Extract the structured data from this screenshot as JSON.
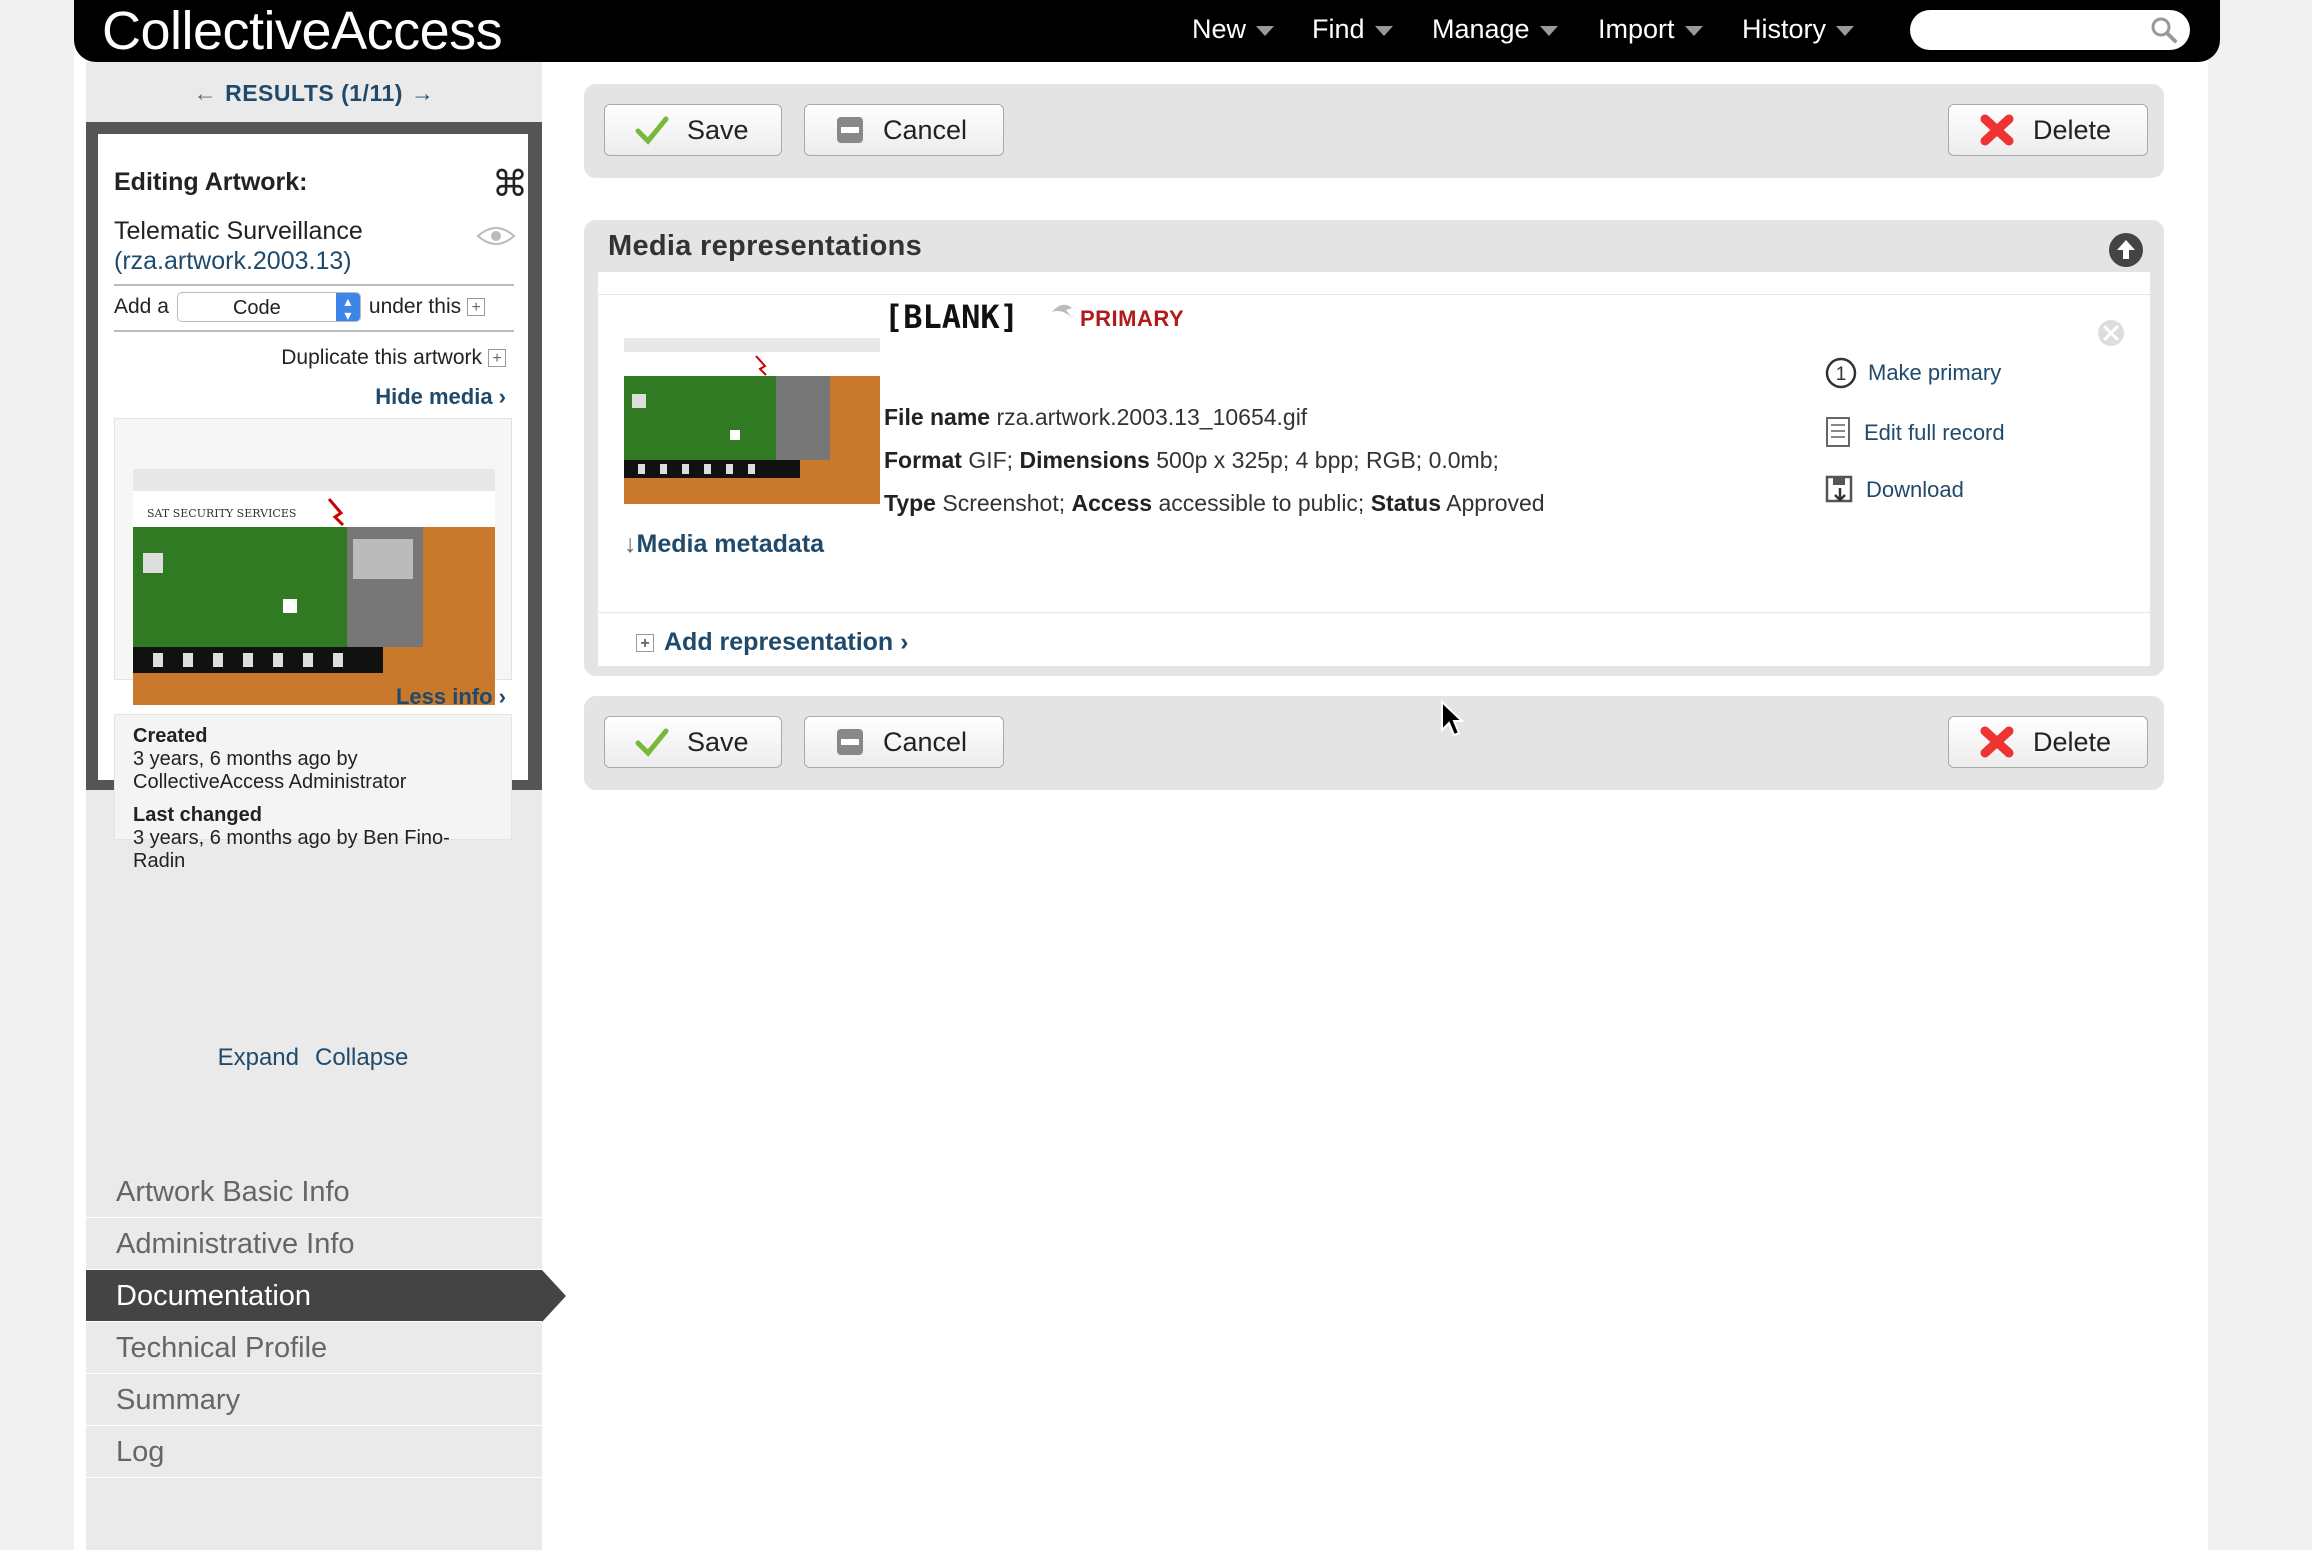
{
  "app": {
    "logo": "CollectiveAccess"
  },
  "nav": {
    "items": [
      {
        "label": "New"
      },
      {
        "label": "Find"
      },
      {
        "label": "Manage"
      },
      {
        "label": "Import"
      },
      {
        "label": "History"
      }
    ],
    "search": {
      "value": "",
      "placeholder": ""
    }
  },
  "results": {
    "label": "RESULTS (1/11)",
    "prev": "←",
    "next": "→"
  },
  "inspector": {
    "heading": "Editing Artwork:",
    "object_name": "Telematic Surveillance",
    "object_id": "(rza.artwork.2003.13)",
    "add_prefix": "Add a",
    "add_type_value": "Code",
    "add_suffix": "under this",
    "duplicate_label": "Duplicate this artwork",
    "hide_media": "Hide media ›",
    "less_info": "Less info ›",
    "created_label": "Created",
    "created_value": "3 years, 6 months ago by CollectiveAccess Administrator",
    "changed_label": "Last changed",
    "changed_value": "3 years, 6 months ago by Ben Fino-Radin",
    "expand": "Expand",
    "collapse": "Collapse"
  },
  "sidenav": {
    "items": [
      {
        "label": "Artwork Basic Info"
      },
      {
        "label": "Administrative Info"
      },
      {
        "label": "Documentation"
      },
      {
        "label": "Technical Profile"
      },
      {
        "label": "Summary"
      },
      {
        "label": "Log"
      }
    ],
    "active": "Documentation"
  },
  "toolbar": {
    "save": "Save",
    "cancel": "Cancel",
    "delete": "Delete"
  },
  "media_panel": {
    "title": "Media representations",
    "representation": {
      "title": "[BLANK]",
      "badge": "PRIMARY",
      "file_name_label": "File name",
      "file_name": "rza.artwork.2003.13_10654.gif",
      "format_label": "Format",
      "format": "GIF;",
      "dimensions_label": "Dimensions",
      "dimensions": "500p x 325p; 4 bpp; RGB; 0.0mb;",
      "type_label": "Type",
      "type": "Screenshot;",
      "access_label": "Access",
      "access": "accessible to public;",
      "status_label": "Status",
      "status": "Approved",
      "media_metadata": "Media metadata",
      "actions": {
        "make_primary": "Make primary",
        "edit_full_record": "Edit full record",
        "download": "Download"
      }
    },
    "add_representation": "Add representation ›"
  },
  "colors": {
    "link": "#1f4a6c",
    "primary_badge": "#b01c1c",
    "active_nav": "#444444",
    "topbar": "#000000"
  }
}
